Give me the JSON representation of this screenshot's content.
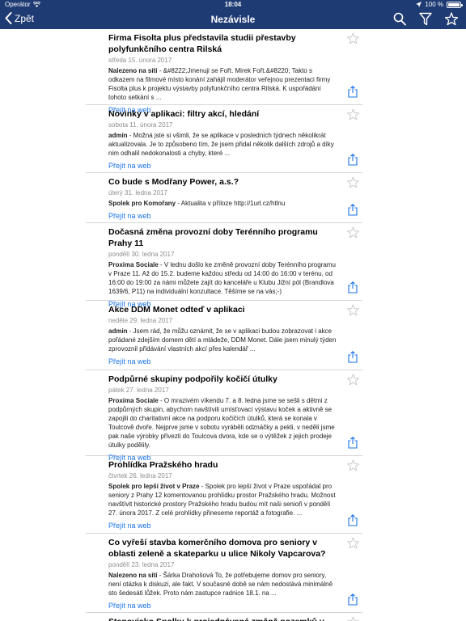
{
  "status": {
    "carrier": "Operátor",
    "time": "18:04",
    "battery": "100 %",
    "battery_level": 1.0
  },
  "nav": {
    "back_label": "Zpět",
    "title": "Nezávisle",
    "icons": [
      "search-icon",
      "filter-icon",
      "star-icon"
    ]
  },
  "colors": {
    "nav_bg": "#1f3b73",
    "link": "#1a73e8",
    "muted": "#8e8e93",
    "star": "#c7c7cc"
  },
  "items": [
    {
      "title": "Firma Fisolta plus představila studii přestavby polyfunkčního centra Rilská",
      "date": "středa 15. února 2017",
      "source": "Nalezeno na síti",
      "text": " - &#8222;Jmenuji se Fořt. Mirek Fořt.&#8220; Takto s odkazem na filmové místo konání zahájil moderátor veřejnou prezentaci firmy Fisolta plus k projektu výstavby polyfunkčního centra Rilská. K uspořádání tohoto setkání s ...",
      "link": "Přejít na web"
    },
    {
      "title": "Novinky v aplikaci: filtry akcí, hledání",
      "date": "sobota 11. února 2017",
      "source": "admin",
      "text": " - Možná jste si všimli, že se aplikace v posledních týdnech několikrát aktualizovala. Je to způsobeno tím, že jsem přidal několik dalších zdrojů a díky nim odhalil nedokonalosti a chyby, které ...",
      "link": "Přejít na web"
    },
    {
      "title": "Co bude s Modřany Power, a.s.?",
      "date": "úterý 31. ledna 2017",
      "source": "Spolek pro Komořany",
      "text": " - Aktualita v příloze  http://1url.cz/htlnu",
      "link": "Přejít na web"
    },
    {
      "title": "Dočasná změna provozní doby Terénního programu Prahy 11",
      "date": "pondělí 30. ledna 2017",
      "source": "Proxima Sociale",
      "text": " - V lednu došlo ke změně provozní doby Terénního programu v Praze 11. Až do 15.2. budeme každou středu od 14:00 do 16:00 v terénu, od 16:00 do 19:00 za námi můžete zajít do kanceláře u Klubu Jižní pól (Brandlova 1639/6, P11) na individuální konzultace. Těšíme se na vás;-)",
      "link": "Přejít na web"
    },
    {
      "title": "Akce DDM Monet odteď v aplikaci",
      "date": "neděle 29. ledna 2017",
      "source": "admin",
      "text": " - Jsem rád, že můžu oznámit, že se v aplikaci budou zobrazovat i akce pořádané zdejším domem dětí a mládeže, DDM Monet. Dále jsem minulý týden zprovoznil přidávání vlastních akcí přes kalendář ...",
      "link": "Přejít na web"
    },
    {
      "title": "Podpůrné skupiny podpořily kočičí útulky",
      "date": "pátek 27. ledna 2017",
      "source": "Proxima Sociale",
      "text": " - O mrazivém víkendu 7. a 8. ledna jsme se sešli s dětmi z podpůrných skupin, abychom navštívili umísťovací výstavu koček a aktivně se zapojili do charitativní akce na podporu kočičích útulků, která se konala v Toulcově dvoře. Nejprve jsme v sobotu vyráběli odznáčky a pekli, v neděli jsme pak naše výrobky přivezli do Toulcova dvora, kde se o výtěžek z jejich prodeje útulky podělily.",
      "link": "Přejít na web"
    },
    {
      "title": "Prohlídka Pražského hradu",
      "date": "čtvrtek 26. ledna 2017",
      "source": "Spolek pro lepší život v Praze",
      "text": " - Spolek pro lepší život v Praze uspořádal pro seniory z Prahy 12 komentovanou prohlídku prostor Pražského hradu. Možnost navštívit historické prostory Pražského hradu budou mít naši senioři v pondělí 27. února 2017. Z celé prohlídky přineseme reportáž a fotografie. ...",
      "link": "Přejít na web"
    },
    {
      "title": "Co vyřeší stavba komerčního domova pro seniory v oblasti zeleně a skateparku u ulice Nikoly Vapcarova?",
      "date": "pondělí 23. ledna 2017",
      "source": "Nalezeno na síti",
      "text": " - Šárka Drahošová To, že potřebujeme domov pro seniory, není otázka k diskuzi, ale fakt. V současné době se nám nedostává minimálně sto šedesáti lůžek. Proto nám zastupce radnice 18.1. na ...",
      "link": "Přejít na web"
    },
    {
      "title": "Stanovisko Spolku k projednávané změně pozemků v ...",
      "date": "",
      "source": "",
      "text": "",
      "link": ""
    }
  ]
}
